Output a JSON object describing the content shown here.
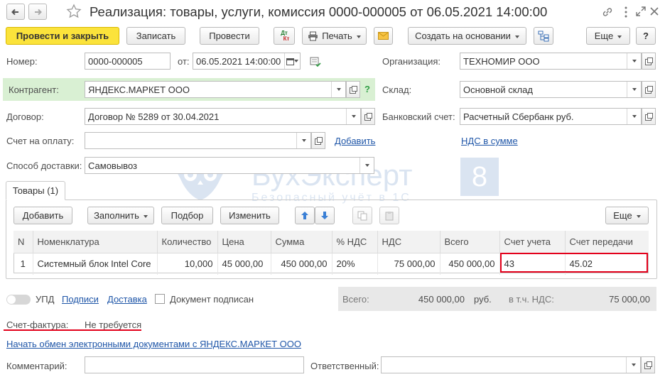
{
  "window": {
    "title": "Реализация: товары, услуги, комиссия 0000-000005 от 06.05.2021 14:00:00"
  },
  "toolbar": {
    "post_close": "Провести и закрыть",
    "save": "Записать",
    "post": "Провести",
    "dtkt_top": "Дт",
    "dtkt_bottom": "Кт",
    "print": "Печать",
    "create_based": "Создать на основании",
    "more": "Еще",
    "help": "?"
  },
  "header": {
    "number_label": "Номер:",
    "number_value": "0000-000005",
    "date_label": "от:",
    "date_value": "06.05.2021 14:00:00",
    "org_label": "Организация:",
    "org_value": "ТЕХНОМИР ООО",
    "contractor_label": "Контрагент:",
    "contractor_value": "ЯНДЕКС.МАРКЕТ ООО",
    "contractor_help": "?",
    "warehouse_label": "Склад:",
    "warehouse_value": "Основной склад",
    "contract_label": "Договор:",
    "contract_value": "Договор № 5289 от 30.04.2021",
    "bank_label": "Банковский счет:",
    "bank_value": "Расчетный Сбербанк руб.",
    "invoice_label": "Счет на оплату:",
    "invoice_value": "",
    "add_link": "Добавить",
    "vat_link": "НДС в сумме",
    "delivery_label": "Способ доставки:",
    "delivery_value": "Самовывоз"
  },
  "watermark": {
    "brand": "БухЭксперт",
    "digit": "8",
    "tagline": "Безопасный учёт в 1С"
  },
  "tabs": {
    "goods": "Товары (1)"
  },
  "table_toolbar": {
    "add": "Добавить",
    "fill": "Заполнить",
    "select": "Подбор",
    "edit": "Изменить",
    "more": "Еще"
  },
  "table": {
    "columns": [
      "N",
      "Номенклатура",
      "Количество",
      "Цена",
      "Сумма",
      "% НДС",
      "НДС",
      "Всего",
      "Счет учета",
      "Счет передачи"
    ],
    "rows": [
      [
        "1",
        "Системный блок Intel Core",
        "10,000",
        "45 000,00",
        "450 000,00",
        "20%",
        "75 000,00",
        "450 000,00",
        "43",
        "45.02"
      ]
    ]
  },
  "footer": {
    "upd": "УПД",
    "signatures_link": "Подписи",
    "delivery_link": "Доставка",
    "signed_label": "Документ подписан",
    "total_label": "Всего:",
    "total_value": "450 000,00",
    "currency": "руб.",
    "vat_incl_label": "в т.ч. НДС:",
    "vat_value": "75 000,00",
    "invoice_doc_label": "Счет-фактура:",
    "invoice_doc_value": "Не требуется",
    "edo_link": "Начать обмен электронными документами с ЯНДЕКС.МАРКЕТ ООО",
    "comment_label": "Комментарий:",
    "comment_value": "",
    "responsible_label": "Ответственный:",
    "responsible_value": ""
  },
  "colors": {
    "primary_button": "#fbe33b",
    "link": "#1f56a8",
    "highlight_red": "#e3001b",
    "contractor_bg": "#d9f0d3",
    "totals_bg": "#e8e8e8"
  }
}
